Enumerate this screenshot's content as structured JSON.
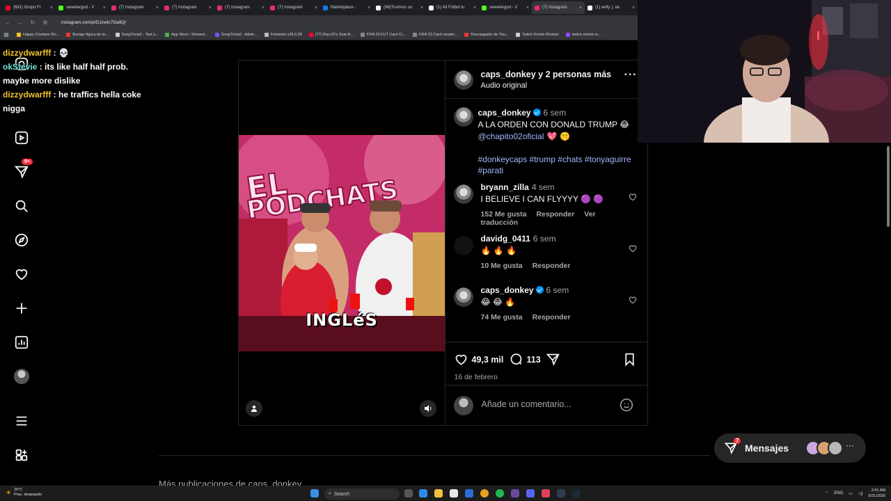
{
  "browser": {
    "tabs": [
      {
        "title": "(681) Grupo Fr",
        "color": "#ff0033"
      },
      {
        "title": "sweetergod - V",
        "color": "#53fc18"
      },
      {
        "title": "(7) Instagram",
        "color": "#e1306c"
      },
      {
        "title": "(7) Instagram",
        "color": "#e1306c"
      },
      {
        "title": "(7) Instagram",
        "color": "#e1306c"
      },
      {
        "title": "(7) Instagram",
        "color": "#e1306c"
      },
      {
        "title": "Marketplace - ",
        "color": "#1877f2"
      },
      {
        "title": "(96)Tuvimos un",
        "color": "#ffffff"
      },
      {
        "title": "(1) All Fútbol tu",
        "color": "#ffffff"
      },
      {
        "title": "sweetergod - V",
        "color": "#53fc18"
      },
      {
        "title": "(7) Instagram",
        "color": "#e1306c"
      },
      {
        "title": "(1) avify ), oe",
        "color": "#ffffff"
      }
    ],
    "url": "instagram.com/p/DJzwtc7Da9Q/",
    "bookmarks": [
      {
        "label": "Happy Cristiano Ro...",
        "color": "#f5c518"
      },
      {
        "label": "Burago figura de to...",
        "color": "#e53935"
      },
      {
        "label": "SongTrivia2 - Test y...",
        "color": "#cccccc"
      },
      {
        "label": "App Store / Streami...",
        "color": "#4caf50"
      },
      {
        "label": "SongTrivia2 - Advin...",
        "color": "#7c4dff"
      },
      {
        "label": "Feletools v26.0.28",
        "color": "#bbbbbb"
      },
      {
        "label": "(77) Racc97s Zeal-A...",
        "color": "#ff0033"
      },
      {
        "label": "FIFA 23 FUT Card Cr...",
        "color": "#888888"
      },
      {
        "label": "FIFA 23 Card creator...",
        "color": "#888888"
      },
      {
        "label": "Descargador de You...",
        "color": "#e53935"
      },
      {
        "label": "Twitch Emote Resizer",
        "color": "#cccccc"
      },
      {
        "label": "twitch emote re...",
        "color": "#9146ff"
      }
    ]
  },
  "chat": [
    {
      "user": "dizzydwarfff",
      "message": "💀",
      "user_color": "#f1c232"
    },
    {
      "user": "okStevie",
      "message": "its like half half prob. maybe more dislike",
      "user_color": "#6fe3d6"
    },
    {
      "user": "dizzydwarfff",
      "message": "he traffics hella coke nigga",
      "user_color": "#f1c232"
    }
  ],
  "rail": {
    "notifications_badge": "9+"
  },
  "post": {
    "header_user": "caps_donkey y 2 personas más",
    "header_sub": "Audio original",
    "video_caption": "INGLéS",
    "caption": {
      "user": "caps_donkey",
      "time": "6 sem",
      "text": "A LA ORDEN CON DONALD TRUMP 😂",
      "mention": "@chapito02oficial",
      "mention_suffix": "💖 🤫",
      "hashtags": "#donkeycaps #trump #chats #tonyaguirre #parati"
    },
    "comments": [
      {
        "user": "bryann_zilla",
        "time": "4 sem",
        "text": "I BELIEVE I CAN FLYYYY 🟣 🟣",
        "likes": "152 Me gusta",
        "reply": "Responder",
        "translate": "Ver traducción",
        "verified": false
      },
      {
        "user": "davidg_0411",
        "time": "6 sem",
        "text": "🔥 🔥 🔥",
        "likes": "10 Me gusta",
        "reply": "Responder",
        "translate": "",
        "verified": false
      },
      {
        "user": "caps_donkey",
        "time": "6 sem",
        "text": "😂 😂 🔥",
        "likes": "74 Me gusta",
        "reply": "Responder",
        "translate": "",
        "verified": true
      }
    ],
    "like_count": "49,3 mil",
    "comment_count": "113",
    "date": "16 de febrero",
    "add_comment_placeholder": "Añade un comentario..."
  },
  "more_posts_title": "Más publicaciones de caps_donkey",
  "messages": {
    "label": "Mensajes",
    "badge": "7"
  },
  "taskbar": {
    "weather_temp": "20°C",
    "weather_desc": "Prac. despejado",
    "search_label": "Search",
    "lang": "ENG",
    "time": "2:41 AM",
    "date": "5/31/2026"
  }
}
